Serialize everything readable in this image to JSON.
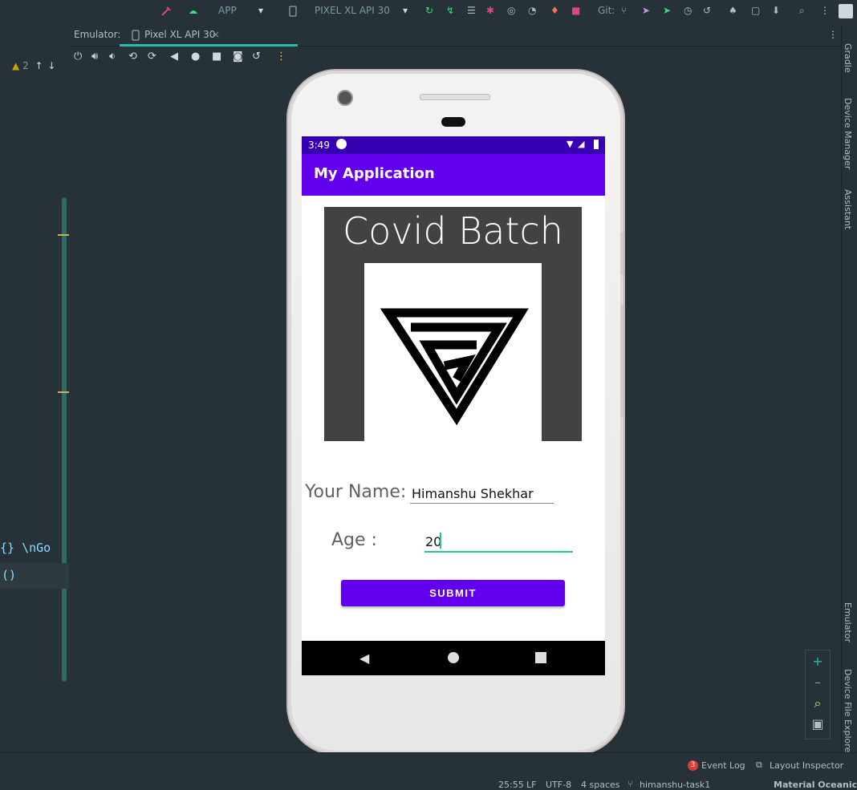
{
  "toolbar": {
    "run_config": "APP",
    "device": "PIXEL XL API 30",
    "git_label": "Git:"
  },
  "emulator_tabs": {
    "panel_label": "Emulator:",
    "active_tab": "Pixel XL API 30",
    "close_glyph": "×"
  },
  "editor": {
    "warning_count": "2",
    "code_line_1": "{} \\nGo",
    "code_line_2": "()"
  },
  "device_screen": {
    "status_time": "3:49",
    "app_title": "My Application",
    "card_title": "Covid Batch",
    "name_label": "Your Name:",
    "name_value": "Himanshu Shekhar",
    "age_label": "Age :",
    "age_value": "20",
    "submit_label": "SUBMIT"
  },
  "right_panel": {
    "gradle": "Gradle",
    "device_manager": "Device Manager",
    "assistant": "Assistant",
    "emulator": "Emulator",
    "device_file_explorer": "Device File Explorer"
  },
  "bottom_bar": {
    "event_log_count": "3",
    "event_log": "Event Log",
    "layout_inspector": "Layout Inspector",
    "cursor_pos": "25:55",
    "line_sep": "LF",
    "encoding": "UTF-8",
    "indent": "4 spaces",
    "branch": "himanshu-task1",
    "theme": "Material Oceanic"
  },
  "colors": {
    "app_primary": "#6200ee",
    "app_primary_dark": "#3700b3",
    "ide_background": "#263238",
    "accent_teal": "#2bbbad"
  }
}
